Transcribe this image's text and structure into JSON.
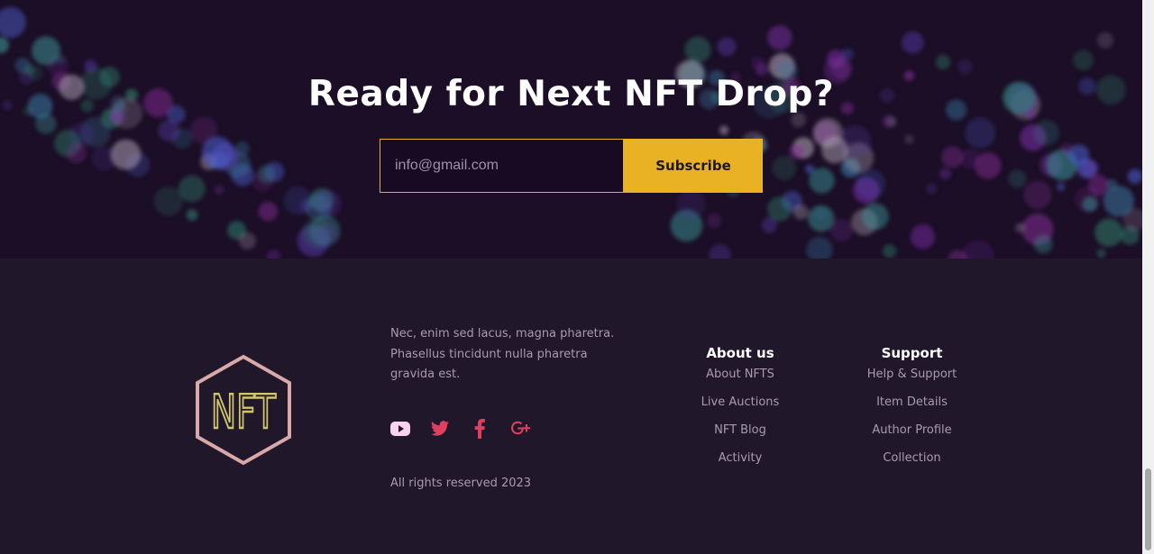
{
  "newsletter": {
    "title": "Ready for Next NFT Drop?",
    "email_placeholder": "info@gmail.com",
    "subscribe_label": "Subscribe"
  },
  "footer": {
    "logo_text": "NFT",
    "about_text": "Nec, enim sed lacus, magna pharetra. Phasellus tincidunt nulla pharetra gravida est.",
    "social_icons": [
      "youtube-icon",
      "twitter-icon",
      "facebook-icon",
      "google-plus-icon"
    ],
    "copyright": "All rights reserved 2023",
    "columns": [
      {
        "title": "About us",
        "links": [
          "About NFTS",
          "Live Auctions",
          "NFT Blog",
          "Activity"
        ]
      },
      {
        "title": "Support",
        "links": [
          "Help & Support",
          "Item Details",
          "Author Profile",
          "Collection"
        ]
      }
    ]
  },
  "colors": {
    "accent": "#e8b224",
    "hero_background": "#1b0e26",
    "footer_background": "#21172a",
    "social_icon": "#e0405f",
    "logo_outline": "#d9a9a9",
    "logo_letters": "#cfc56a"
  }
}
